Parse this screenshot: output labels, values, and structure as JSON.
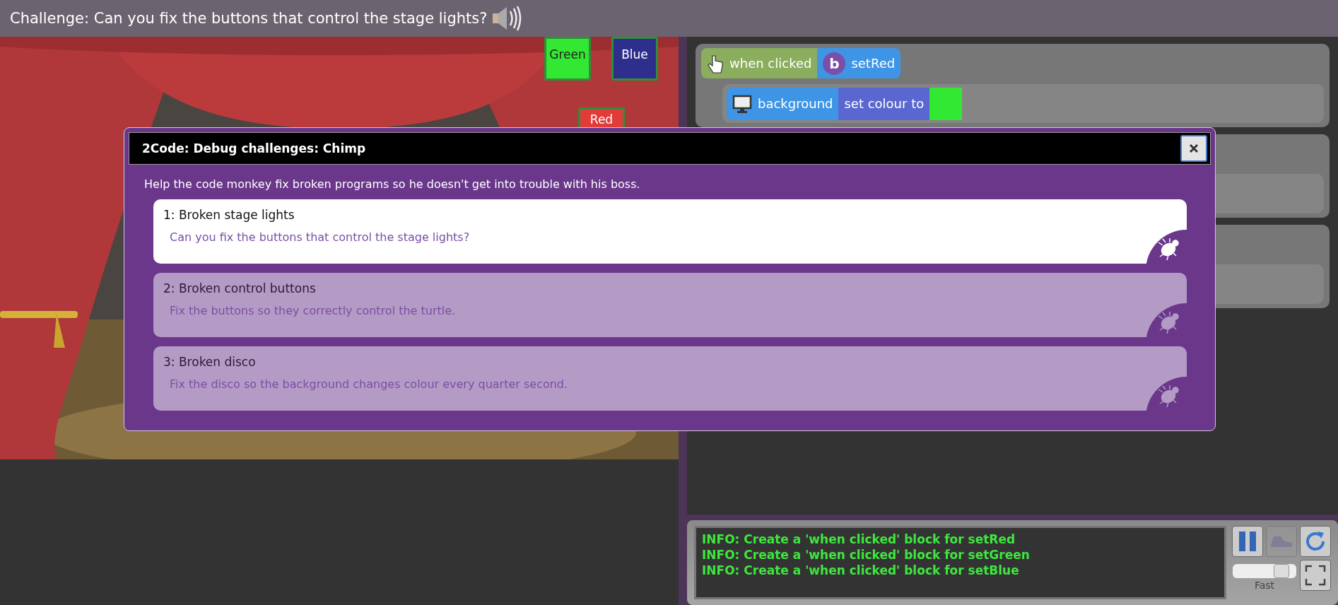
{
  "header": {
    "title": "Challenge: Can you fix the buttons that control the stage lights?"
  },
  "stage": {
    "buttons": [
      {
        "label": "Green",
        "color": "#33e833"
      },
      {
        "label": "Blue",
        "color": "#2e2f8c"
      },
      {
        "label": "Red",
        "color": "#e33a3a"
      }
    ]
  },
  "code": {
    "blocks": [
      {
        "event": "when clicked",
        "badge": "b",
        "target": "setRed",
        "object": "background",
        "action": "set colour to",
        "color": "#33e833"
      }
    ]
  },
  "dialog": {
    "title": "2Code: Debug challenges: Chimp",
    "intro": "Help the code monkey fix broken programs so he doesn't get into trouble with his boss.",
    "challenges": [
      {
        "title": "1: Broken stage lights",
        "description": "Can you fix the buttons that control the stage lights?",
        "selected": true
      },
      {
        "title": "2: Broken control buttons",
        "description": "Fix the buttons so they correctly control the turtle.",
        "selected": false
      },
      {
        "title": "3: Broken disco",
        "description": "Fix the disco so the background changes colour every quarter second.",
        "selected": false
      }
    ]
  },
  "console": {
    "lines": [
      "INFO: Create a 'when clicked' block for setRed",
      "INFO: Create a 'when clicked' block for setGreen",
      "INFO: Create a 'when clicked' block for setBlue"
    ],
    "controls": [
      {
        "kind": "pause",
        "disabled": false
      },
      {
        "kind": "step",
        "disabled": true
      },
      {
        "kind": "restart",
        "disabled": false
      },
      {
        "kind": "fullscreen",
        "disabled": false
      }
    ],
    "speed": {
      "level": 0.85,
      "label": "Fast"
    }
  }
}
